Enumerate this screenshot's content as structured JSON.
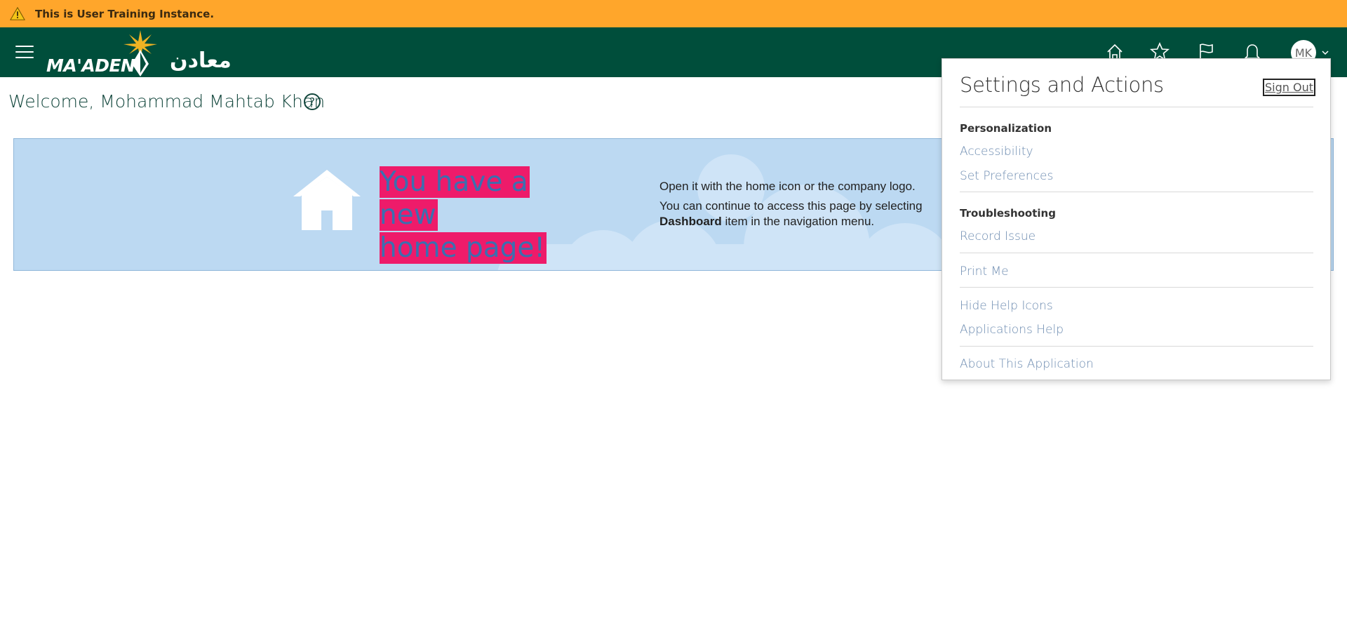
{
  "training_banner": {
    "text": "This is User Training Instance."
  },
  "header": {
    "logo_latin": "MA'ADEN",
    "logo_arabic": "معادن",
    "avatar_initials": "MK"
  },
  "welcome": {
    "text": "Welcome, Mohammad Mahtab Khan",
    "help_glyph": "?"
  },
  "promo": {
    "headline_line1": "You have a new",
    "headline_line2": "home page!",
    "desc_line1": "Open it with the home icon or the company logo.",
    "desc_line2": "You can continue to access this page by selecting",
    "desc_bold": "Dashboard",
    "desc_line3_rest": " item in the navigation menu."
  },
  "settings_popup": {
    "title": "Settings and Actions",
    "sign_out": "Sign Out",
    "sections": {
      "personalization_label": "Personalization",
      "accessibility": "Accessibility",
      "set_preferences": "Set Preferences",
      "troubleshooting_label": "Troubleshooting",
      "record_issue": "Record Issue",
      "print_me": "Print Me",
      "hide_help_icons": "Hide Help Icons",
      "applications_help": "Applications Help",
      "about": "About This Application"
    }
  },
  "colors": {
    "banner": "#ffa62b",
    "header": "#004e3b",
    "promo_bg": "#bcd9f2",
    "headline_highlight": "#ee1b6a",
    "link": "#6c8bb0"
  },
  "icons": [
    "warning-icon",
    "menu-icon",
    "home-icon",
    "star-icon",
    "flag-icon",
    "bell-icon",
    "chevron-down-icon",
    "help-icon",
    "house-icon"
  ]
}
